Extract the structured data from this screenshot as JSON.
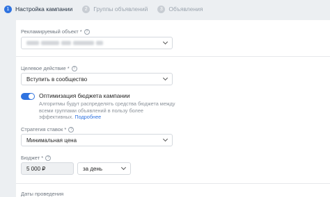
{
  "steps": [
    {
      "num": "1",
      "label": "Настройка кампании"
    },
    {
      "num": "2",
      "label": "Группы объявлений"
    },
    {
      "num": "3",
      "label": "Объявления"
    }
  ],
  "fields": {
    "advertised_object": {
      "label": "Рекламируемый объект *",
      "help": "?"
    },
    "target_action": {
      "label": "Целевое действие *",
      "help": "?",
      "value": "Вступить в сообщество"
    },
    "optimization": {
      "title": "Оптимизация бюджета кампании",
      "desc_line1": "Алгоритмы будут распределять средства бюджета между",
      "desc_line2": "всеми группами объявлений в пользу более",
      "desc_line3_prefix": "эффективных.",
      "desc_link": "Подробнее",
      "enabled": true
    },
    "bid_strategy": {
      "label": "Стратегия ставок *",
      "help": "?",
      "value": "Минимальная цена"
    },
    "budget": {
      "label": "Бюджет *",
      "help": "?",
      "value": "5 000 ₽",
      "period": "за день"
    },
    "dates": {
      "label": "Даты проведения"
    }
  },
  "colors": {
    "accent": "#2f73e0"
  }
}
